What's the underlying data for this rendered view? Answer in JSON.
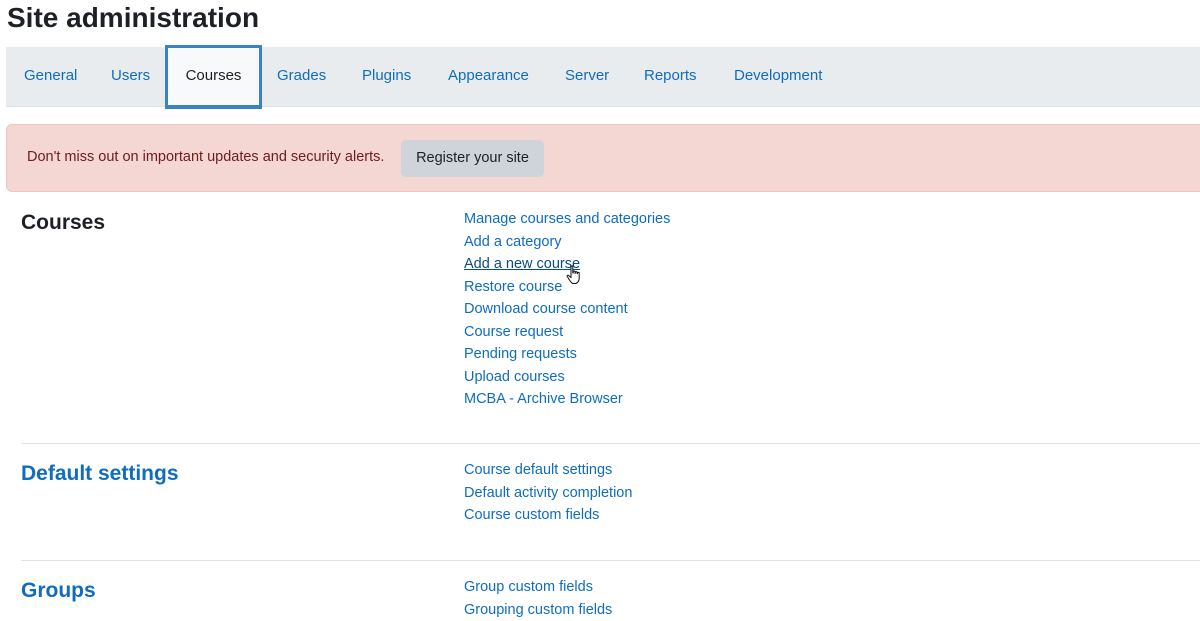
{
  "page": {
    "title": "Site administration"
  },
  "tabs": [
    {
      "label": "General"
    },
    {
      "label": "Users"
    },
    {
      "label": "Courses",
      "active": true
    },
    {
      "label": "Grades"
    },
    {
      "label": "Plugins"
    },
    {
      "label": "Appearance"
    },
    {
      "label": "Server"
    },
    {
      "label": "Reports"
    },
    {
      "label": "Development"
    }
  ],
  "alert": {
    "message": "Don't miss out on important updates and security alerts.",
    "button_label": "Register your site"
  },
  "sections": [
    {
      "heading": "Courses",
      "links": [
        "Manage courses and categories",
        "Add a category",
        "Add a new course",
        "Restore course",
        "Download course content",
        "Course request",
        "Pending requests",
        "Upload courses",
        "MCBA - Archive Browser"
      ]
    },
    {
      "heading": "Default settings",
      "links": [
        "Course default settings",
        "Default activity completion",
        "Course custom fields"
      ]
    },
    {
      "heading": "Groups",
      "links": [
        "Group custom fields",
        "Grouping custom fields"
      ]
    }
  ],
  "colors": {
    "link": "#0f6cbf",
    "tabbar_bg": "#e9ecef",
    "active_tab_border": "#3b82c4",
    "alert_bg": "#f4d6d2",
    "alert_text": "#6e1d1d",
    "button_bg": "#ced4da"
  },
  "cursor": {
    "icon": "hand-pointer-icon"
  }
}
